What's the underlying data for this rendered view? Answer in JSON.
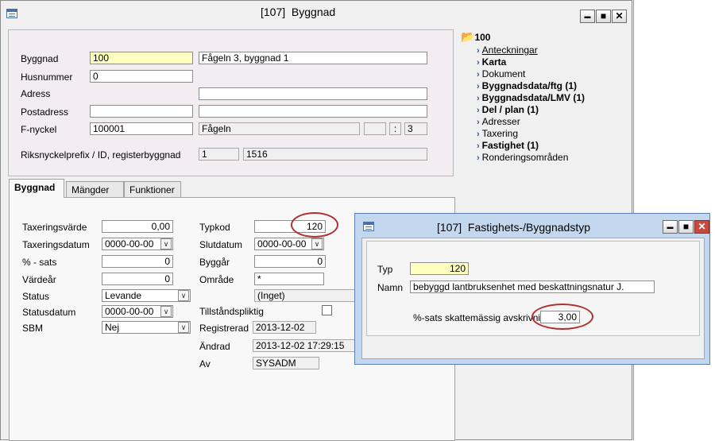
{
  "main_window": {
    "title": "[107]  Byggnad",
    "controls": {
      "minimize": "▬",
      "maximize": "■",
      "close": "✕"
    }
  },
  "header_form": {
    "byggnad": {
      "label": "Byggnad",
      "id": "100",
      "name": "Fågeln 3, byggnad 1"
    },
    "husnummer": {
      "label": "Husnummer",
      "value": "0"
    },
    "adress": {
      "label": "Adress",
      "value": ""
    },
    "postadress": {
      "label": "Postadress",
      "code": "",
      "city": ""
    },
    "fnyckel": {
      "label": "F-nyckel",
      "id": "100001",
      "name": "Fågeln",
      "part1": "",
      "sep": ":",
      "part2": "3"
    },
    "riksnyckel": {
      "label": "Riksnyckelprefix / ID, registerbyggnad",
      "prefix": "1",
      "id": "1516"
    }
  },
  "sidebar": {
    "root": "100",
    "items": [
      {
        "label": "Anteckningar",
        "bold": false,
        "underline": true
      },
      {
        "label": "Karta",
        "bold": true,
        "underline": false
      },
      {
        "label": "Dokument",
        "bold": false,
        "underline": false
      },
      {
        "label": "Byggnadsdata/ftg (1)",
        "bold": true,
        "underline": false
      },
      {
        "label": "Byggnadsdata/LMV (1)",
        "bold": true,
        "underline": false
      },
      {
        "label": "Del / plan (1)",
        "bold": true,
        "underline": false
      },
      {
        "label": "Adresser",
        "bold": false,
        "underline": false
      },
      {
        "label": "Taxering",
        "bold": false,
        "underline": false
      },
      {
        "label": "Fastighet (1)",
        "bold": true,
        "underline": false
      },
      {
        "label": "Ronderingsområden",
        "bold": false,
        "underline": false
      }
    ]
  },
  "tabs": [
    "Byggnad",
    "Mängder",
    "Funktioner"
  ],
  "byggnad_tab": {
    "taxeringsvarde": {
      "label": "Taxeringsvärde",
      "value": "0,00"
    },
    "taxeringsdatum": {
      "label": "Taxeringsdatum",
      "value": "0000-00-00"
    },
    "procent_sats": {
      "label": "% - sats",
      "value": "0"
    },
    "vardear": {
      "label": "Värdeår",
      "value": "0"
    },
    "status": {
      "label": "Status",
      "value": "Levande"
    },
    "statusdatum": {
      "label": "Statusdatum",
      "value": "0000-00-00"
    },
    "sbm": {
      "label": "SBM",
      "value": "Nej"
    },
    "typkod": {
      "label": "Typkod",
      "value": "120"
    },
    "slutdatum": {
      "label": "Slutdatum",
      "value": "0000-00-00"
    },
    "byggar": {
      "label": "Byggår",
      "value": "0"
    },
    "omrade": {
      "label": "Område",
      "value": "*",
      "name": "(Inget)"
    },
    "tillstandspliktig": {
      "label": "Tillståndspliktig"
    },
    "registrerad": {
      "label": "Registrerad",
      "value": "2013-12-02"
    },
    "andrad": {
      "label": "Ändrad",
      "value": "2013-12-02 17:29:15"
    },
    "av": {
      "label": "Av",
      "value": "SYSADM"
    }
  },
  "popup_window": {
    "title": "[107]  Fastighets-/Byggnadstyp",
    "controls": {
      "minimize": "▬",
      "maximize": "■",
      "close": "✕"
    },
    "typ": {
      "label": "Typ",
      "value": "120"
    },
    "namn": {
      "label": "Namn",
      "value": "bebyggd lantbruksenhet med beskattningsnatur J."
    },
    "sats": {
      "label": "%-sats skattemässig avskrivning",
      "value": "3,00"
    }
  },
  "colors": {
    "highlight_circle": "#b03030",
    "key_field": "#ffffc0",
    "accent": "#2b5797"
  }
}
